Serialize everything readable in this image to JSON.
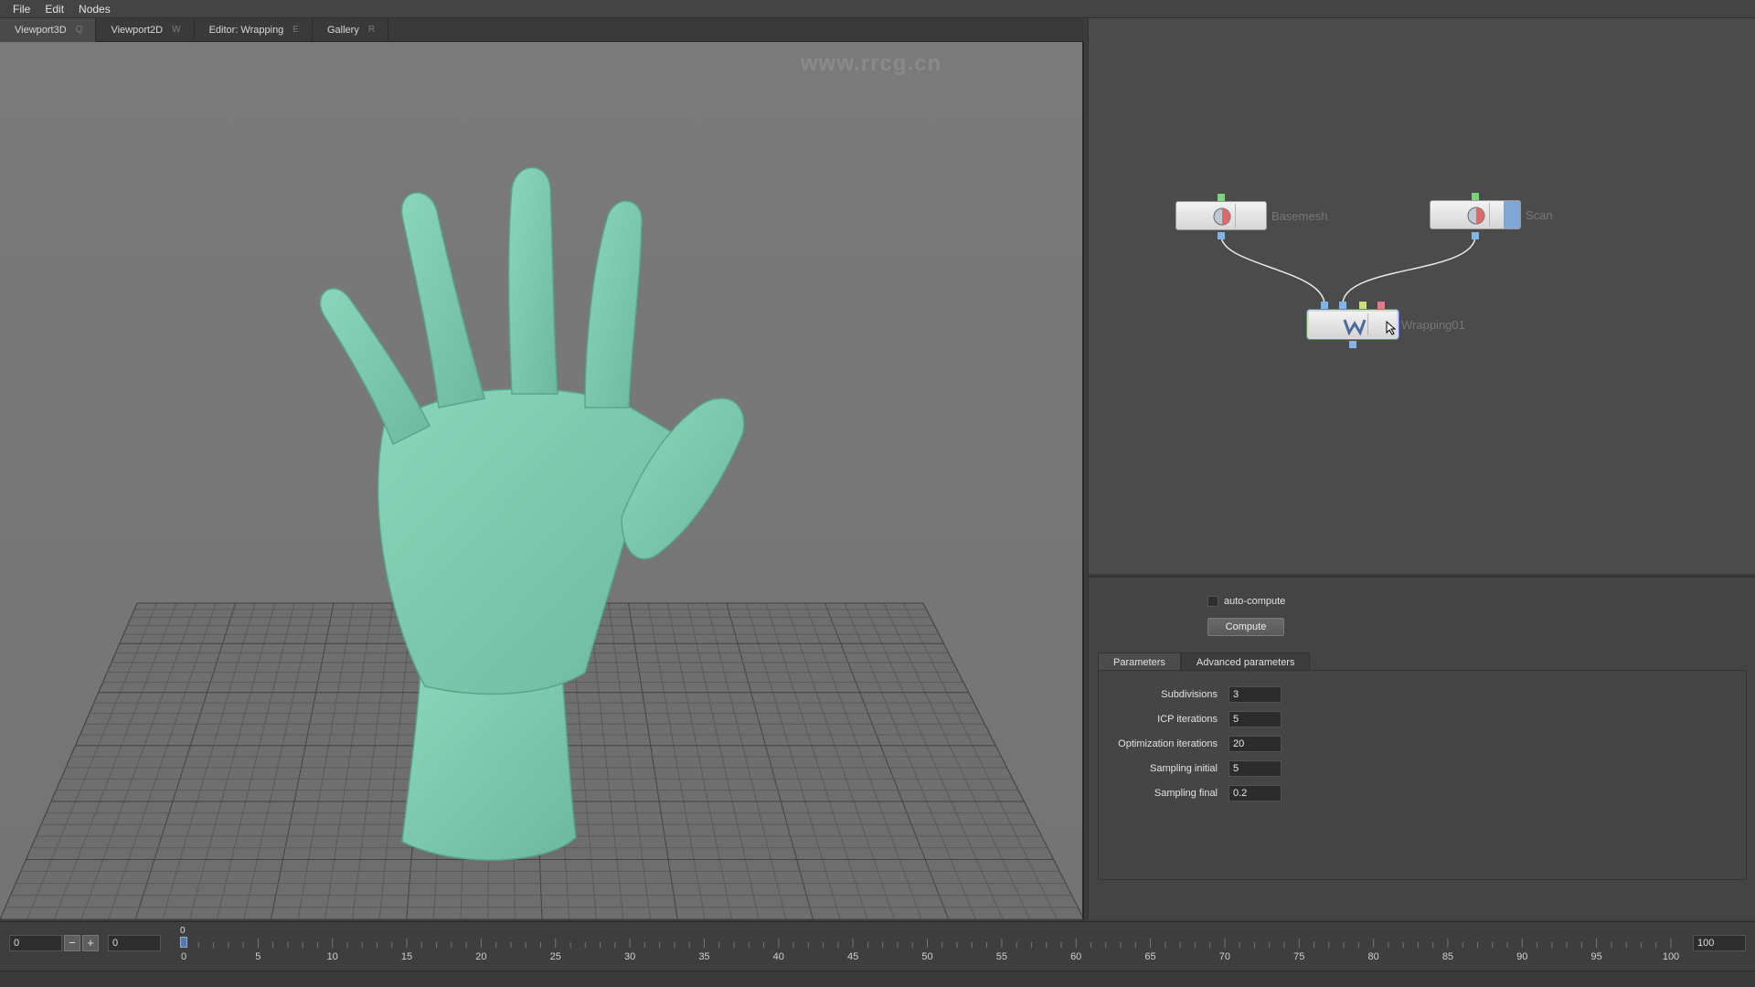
{
  "menu": [
    "File",
    "Edit",
    "Nodes"
  ],
  "tabs": [
    {
      "label": "Viewport3D",
      "hotkey": "Q"
    },
    {
      "label": "Viewport2D",
      "hotkey": "W"
    },
    {
      "label": "Editor: Wrapping",
      "hotkey": "E"
    },
    {
      "label": "Gallery",
      "hotkey": "R"
    }
  ],
  "watermark_url": "www.rrcg.cn",
  "nodes": {
    "basemesh": "Basemesh",
    "scan": "Scan",
    "wrapping": "Wrapping01"
  },
  "props": {
    "auto_compute": "auto-compute",
    "compute_button": "Compute",
    "tabs": [
      "Parameters",
      "Advanced parameters"
    ],
    "params": [
      {
        "label": "Subdivisions",
        "value": "3"
      },
      {
        "label": "ICP iterations",
        "value": "5"
      },
      {
        "label": "Optimization iterations",
        "value": "20"
      },
      {
        "label": "Sampling initial",
        "value": "5"
      },
      {
        "label": "Sampling final",
        "value": "0.2"
      }
    ]
  },
  "timeline": {
    "start": "0",
    "current": "0",
    "end": "100",
    "marker": "0",
    "ticks": [
      "0",
      "5",
      "10",
      "15",
      "20",
      "25",
      "30",
      "35",
      "40",
      "45",
      "50",
      "55",
      "60",
      "65",
      "70",
      "75",
      "80",
      "85",
      "90",
      "95",
      "100"
    ]
  },
  "colors": {
    "mesh": "#7ec9b0",
    "viewport_bg": "#777777",
    "grid": "#4a4a4a"
  }
}
